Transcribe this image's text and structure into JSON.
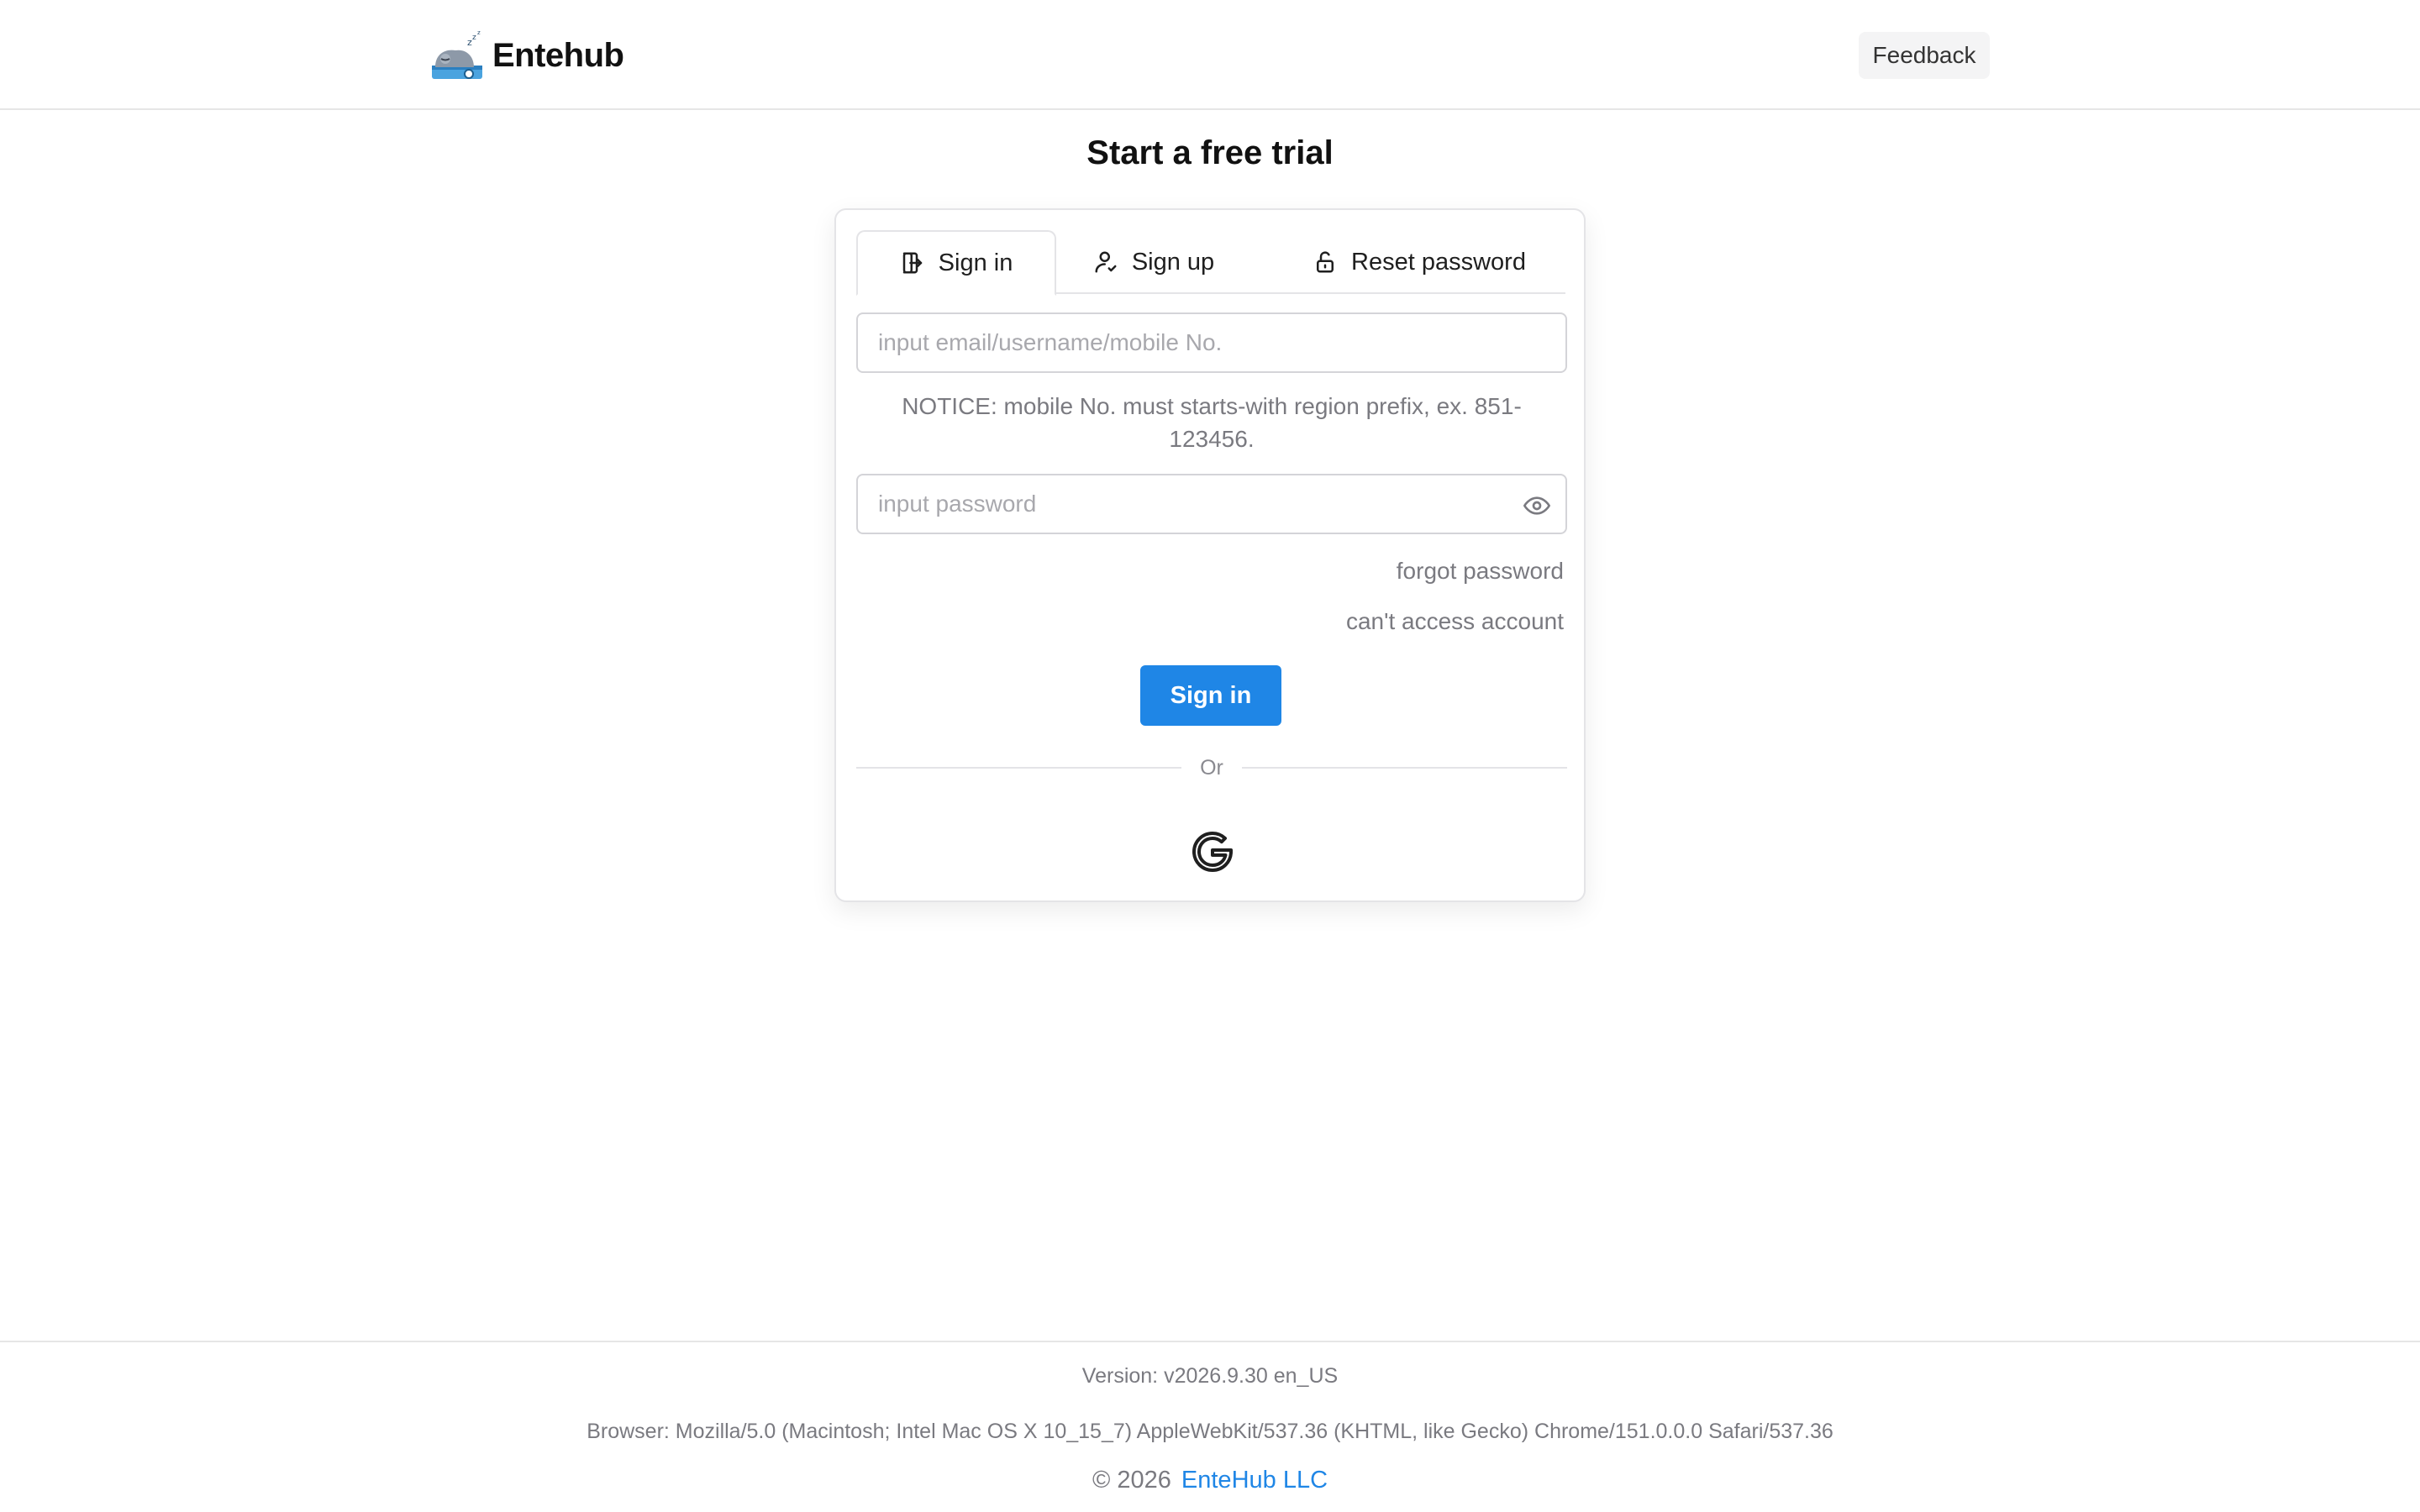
{
  "header": {
    "brand_name": "Entehub",
    "feedback_label": "Feedback"
  },
  "page": {
    "title": "Start a free trial"
  },
  "tabs": [
    {
      "label": "Sign in",
      "icon": "sign-in-icon",
      "active": true
    },
    {
      "label": "Sign up",
      "icon": "user-check-icon",
      "active": false
    },
    {
      "label": "Reset password",
      "icon": "unlock-icon",
      "active": false
    }
  ],
  "form": {
    "email_placeholder": "input email/username/mobile No.",
    "email_value": "",
    "notice": "NOTICE: mobile No. must starts-with region prefix, ex. 851-123456.",
    "password_placeholder": "input password",
    "password_value": "",
    "password_toggle_icon": "eye-icon",
    "forgot_password": "forgot password",
    "cant_access": "can't access account",
    "submit_label": "Sign in",
    "divider_text": "Or",
    "social_icon": "google-icon"
  },
  "footer": {
    "version": "Version: v2026.9.30 en_US",
    "browser": "Browser: Mozilla/5.0 (Macintosh; Intel Mac OS X 10_15_7) AppleWebKit/537.36 (KHTML, like Gecko) Chrome/151.0.0.0 Safari/537.36",
    "copyright": "© 2026",
    "company": "EnteHub LLC"
  },
  "colors": {
    "accent": "#1f86e6",
    "muted_text": "#7a7a80",
    "border": "#e4e4e7"
  }
}
